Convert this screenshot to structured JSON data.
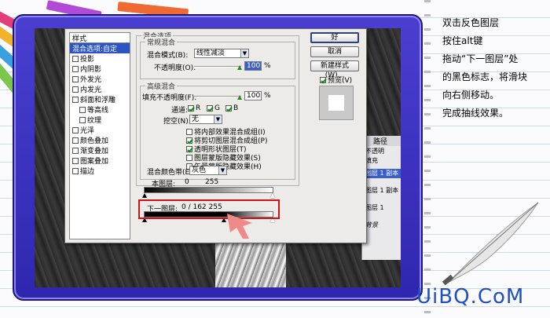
{
  "dialog": {
    "styles_header": "样式",
    "styles": [
      {
        "label": "混合选项:自定",
        "checkbox": false,
        "selected": true,
        "indent": false
      },
      {
        "label": "投影",
        "checkbox": true,
        "checked": false,
        "indent": false
      },
      {
        "label": "内阴影",
        "checkbox": true,
        "checked": false,
        "indent": false
      },
      {
        "label": "外发光",
        "checkbox": true,
        "checked": false,
        "indent": false
      },
      {
        "label": "内发光",
        "checkbox": true,
        "checked": false,
        "indent": false
      },
      {
        "label": "斜面和浮雕",
        "checkbox": true,
        "checked": false,
        "indent": false
      },
      {
        "label": "等高线",
        "checkbox": true,
        "checked": false,
        "indent": true
      },
      {
        "label": "纹理",
        "checkbox": true,
        "checked": false,
        "indent": true
      },
      {
        "label": "光泽",
        "checkbox": true,
        "checked": false,
        "indent": false
      },
      {
        "label": "颜色叠加",
        "checkbox": true,
        "checked": false,
        "indent": false
      },
      {
        "label": "渐变叠加",
        "checkbox": true,
        "checked": false,
        "indent": false
      },
      {
        "label": "图案叠加",
        "checkbox": true,
        "checked": false,
        "indent": false
      },
      {
        "label": "描边",
        "checkbox": true,
        "checked": false,
        "indent": false
      }
    ],
    "blend_options_title": "混合选项",
    "general_blend_title": "常规混合",
    "blend_mode_label": "混合模式(B):",
    "blend_mode_value": "线性减淡",
    "opacity_label": "不透明度(O):",
    "opacity_value": "100",
    "percent": "%",
    "advanced_blend_title": "高级混合",
    "fill_opacity_label": "填充不透明度(F):",
    "fill_opacity_value": "100",
    "channels_label": "通道:",
    "channel_r": "R",
    "channel_g": "G",
    "channel_b": "B",
    "knockout_label": "挖空(N):",
    "knockout_value": "无",
    "advanced_options": [
      {
        "label": "将内部效果混合成组(I)",
        "checked": false
      },
      {
        "label": "将剪切图层混合成组(P)",
        "checked": true
      },
      {
        "label": "透明形状图层(T)",
        "checked": true
      },
      {
        "label": "图层蒙版隐藏效果(S)",
        "checked": false
      },
      {
        "label": "矢量蒙版隐藏效果(H)",
        "checked": false
      }
    ],
    "blend_if_label": "混合颜色带(E):",
    "blend_if_value": "灰色",
    "this_layer_label": "本图层:",
    "this_layer_min": "0",
    "this_layer_max": "255",
    "underlying_label": "下一图层:",
    "underlying_values": "0 / 162   255",
    "underlying_split_fraction": 0.62,
    "buttons": {
      "ok": "好",
      "cancel": "取消",
      "new_style": "新建样式(W)...",
      "preview": "预览(V)"
    },
    "preview_checked": true
  },
  "layers_panel": {
    "tab": "路径",
    "opacity_row": "不透明",
    "fill_row": "填充",
    "rows": [
      "图层 1 副本",
      "图层 1 副本",
      "图层 1",
      "背景"
    ]
  },
  "instructions": [
    "双击反色图层",
    "按住alt键",
    "拖动“下一图层”处",
    "的黑色标志，将滑块",
    "向右侧移动。",
    "完成抽线效果。"
  ],
  "logo": "UiBQ.CoM",
  "colors": {
    "frame": "#3b31c6",
    "highlight_box": "#d0101a",
    "arrow": "#f08a8a",
    "logo": "#1f4fc4"
  }
}
